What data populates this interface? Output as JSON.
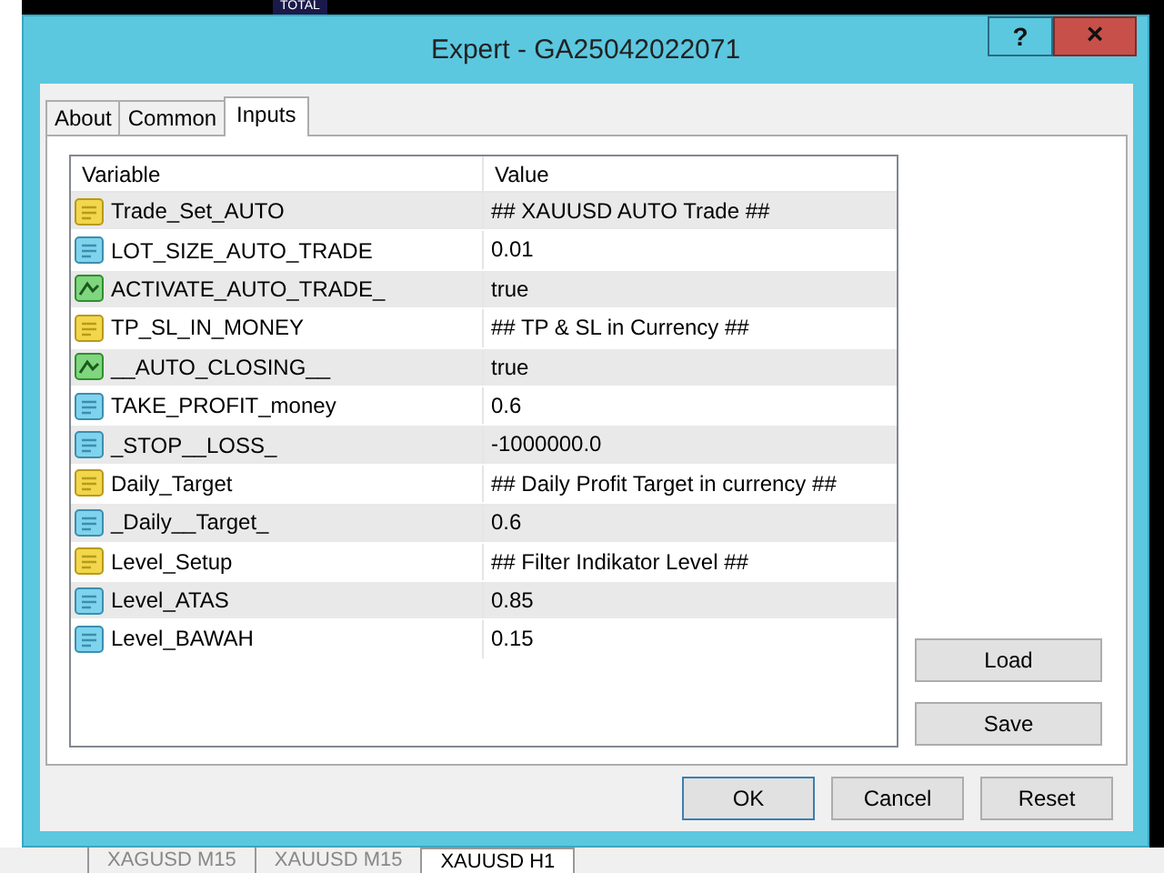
{
  "background": {
    "top_label": "TOTAL",
    "chart_tabs": [
      {
        "label": "XAGUSD M15",
        "selected": false
      },
      {
        "label": "XAUUSD M15",
        "selected": false
      },
      {
        "label": "XAUUSD H1",
        "selected": true
      }
    ]
  },
  "window": {
    "title": "Expert - GA25042022071",
    "help": "?",
    "close": "×"
  },
  "tabs": [
    {
      "label": "About",
      "selected": false
    },
    {
      "label": "Common",
      "selected": false
    },
    {
      "label": "Inputs",
      "selected": true
    }
  ],
  "table": {
    "columns": [
      "Variable",
      "Value"
    ],
    "rows": [
      {
        "kind": "string",
        "variable": "Trade_Set_AUTO",
        "value": "## XAUUSD AUTO Trade ##"
      },
      {
        "kind": "number",
        "variable": "LOT_SIZE_AUTO_TRADE",
        "value": "0.01"
      },
      {
        "kind": "bool",
        "variable": "ACTIVATE_AUTO_TRADE_",
        "value": "true"
      },
      {
        "kind": "string",
        "variable": "TP_SL_IN_MONEY",
        "value": "## TP & SL in Currency ##"
      },
      {
        "kind": "bool",
        "variable": "__AUTO_CLOSING__",
        "value": "true"
      },
      {
        "kind": "number",
        "variable": "TAKE_PROFIT_money",
        "value": "0.6"
      },
      {
        "kind": "number",
        "variable": "_STOP__LOSS_",
        "value": "-1000000.0"
      },
      {
        "kind": "string",
        "variable": "Daily_Target",
        "value": "## Daily Profit Target in currency ##"
      },
      {
        "kind": "number",
        "variable": "_Daily__Target_",
        "value": "0.6"
      },
      {
        "kind": "string",
        "variable": "Level_Setup",
        "value": "## Filter Indikator Level ##"
      },
      {
        "kind": "number",
        "variable": "Level_ATAS",
        "value": "0.85"
      },
      {
        "kind": "number",
        "variable": "Level_BAWAH",
        "value": "0.15"
      }
    ]
  },
  "side_buttons": [
    "Load",
    "Save"
  ],
  "buttons": [
    {
      "label": "OK",
      "default": true
    },
    {
      "label": "Cancel",
      "default": false
    },
    {
      "label": "Reset",
      "default": false
    }
  ]
}
